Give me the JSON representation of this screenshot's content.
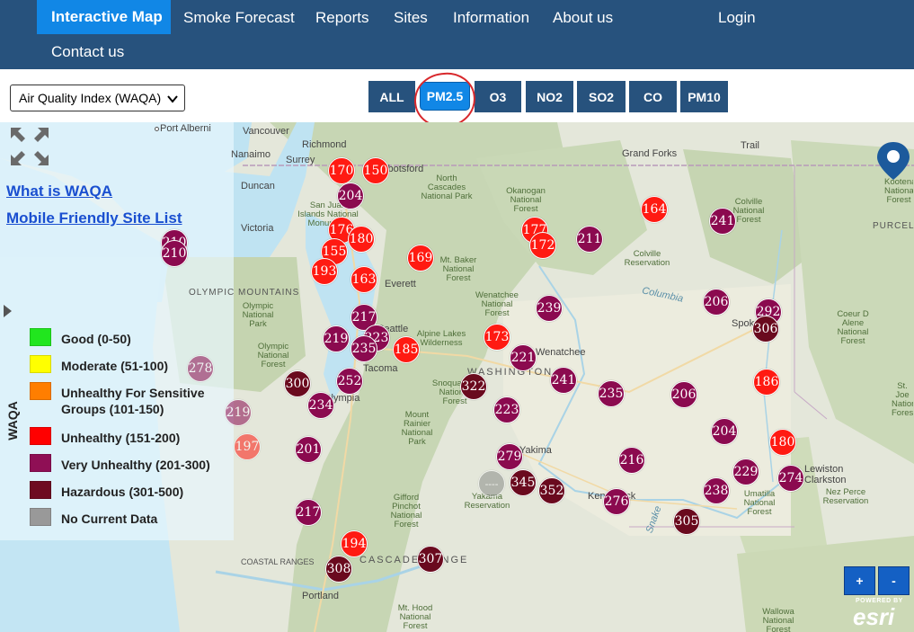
{
  "nav": {
    "items": [
      "Interactive Map",
      "Smoke Forecast",
      "Reports",
      "Sites",
      "Information",
      "About us",
      "Login",
      "Contact us"
    ]
  },
  "toolbar": {
    "select_value": "Air Quality Index (WAQA)",
    "pollutants": [
      "ALL",
      "PM2.5",
      "O3",
      "NO2",
      "SO2",
      "CO",
      "PM10"
    ],
    "active_pollutant": "PM2.5"
  },
  "links": {
    "what_is": "What is WAQA",
    "mobile_list": "Mobile Friendly Site List"
  },
  "legend": {
    "title": "WAQA",
    "items": [
      {
        "label": "Good (0-50)",
        "color": "#21e61e"
      },
      {
        "label": "Moderate (51-100)",
        "color": "#ffff00"
      },
      {
        "label": "Unhealthy For Sensitive Groups (101-150)",
        "color": "#ff7e00"
      },
      {
        "label": "Unhealthy (151-200)",
        "color": "#ff0000"
      },
      {
        "label": "Very Unhealthy (201-300)",
        "color": "#8f0f55"
      },
      {
        "label": "Hazardous (301-500)",
        "color": "#6e0b21"
      },
      {
        "label": "No Current Data",
        "color": "#999999"
      }
    ]
  },
  "map_labels": {
    "cities": [
      "Port Alberni",
      "Vancouver",
      "Richmond",
      "Surrey",
      "Abbotsford",
      "Nanaimo",
      "Duncan",
      "Victoria",
      "Grand Forks",
      "Trail",
      "Wenatchee",
      "Yakima",
      "Kennewick",
      "Lewiston",
      "Clarkston",
      "Portland",
      "Spokane",
      "Olympia",
      "Seattle",
      "Everett",
      "Tacoma"
    ],
    "regions": [
      "OLYMPIC MOUNTAINS",
      "COASTAL RANGES",
      "CASCADE RANGE",
      "WASHINGTON",
      "PURCELL"
    ],
    "parks": [
      "San Juan Islands National Monument",
      "North Cascades National Park",
      "Okanogan National Forest",
      "Colville National Forest",
      "Colville Reservation",
      "Mt. Baker National Forest",
      "Wenatchee National Forest",
      "Alpine Lakes Wilderness",
      "Olympic National Park",
      "Olympic National Forest",
      "Mount Rainier National Park",
      "Snoqualmie National Forest",
      "Gifford Pinchot National Forest",
      "Yakama Reservation",
      "Umatilla National Forest",
      "Nez Perce Reservation",
      "Coeur D Alene National Forest",
      "St. Joe National Forest",
      "Kootenai National Forest",
      "Wallowa National Forest",
      "Mt. Hood National Forest",
      "Columbia",
      "Snake"
    ]
  },
  "monitors": [
    {
      "value": "170",
      "level": "u"
    },
    {
      "value": "150",
      "level": "u"
    },
    {
      "value": "204",
      "level": "vu"
    },
    {
      "value": "176",
      "level": "u"
    },
    {
      "value": "180",
      "level": "u"
    },
    {
      "value": "155",
      "level": "u"
    },
    {
      "value": "193",
      "level": "u"
    },
    {
      "value": "163",
      "level": "u"
    },
    {
      "value": "169",
      "level": "u"
    },
    {
      "value": "210",
      "level": "vu"
    },
    {
      "value": "210",
      "level": "vu"
    },
    {
      "value": "217",
      "level": "vu"
    },
    {
      "value": "219",
      "level": "vu"
    },
    {
      "value": "223",
      "level": "vu"
    },
    {
      "value": "235",
      "level": "vu"
    },
    {
      "value": "185",
      "level": "u"
    },
    {
      "value": "173",
      "level": "u"
    },
    {
      "value": "177",
      "level": "u"
    },
    {
      "value": "172",
      "level": "u"
    },
    {
      "value": "211",
      "level": "vu"
    },
    {
      "value": "164",
      "level": "u"
    },
    {
      "value": "241",
      "level": "vu"
    },
    {
      "value": "239",
      "level": "vu"
    },
    {
      "value": "221",
      "level": "vu"
    },
    {
      "value": "241",
      "level": "vu"
    },
    {
      "value": "206",
      "level": "vu"
    },
    {
      "value": "292",
      "level": "vu"
    },
    {
      "value": "306",
      "level": "hz"
    },
    {
      "value": "278",
      "level": "vu"
    },
    {
      "value": "300",
      "level": "hz"
    },
    {
      "value": "252",
      "level": "vu"
    },
    {
      "value": "234",
      "level": "vu"
    },
    {
      "value": "322",
      "level": "hz"
    },
    {
      "value": "223",
      "level": "vu"
    },
    {
      "value": "235",
      "level": "vu"
    },
    {
      "value": "206",
      "level": "vu"
    },
    {
      "value": "186",
      "level": "u"
    },
    {
      "value": "219",
      "level": "vu"
    },
    {
      "value": "197",
      "level": "u"
    },
    {
      "value": "201",
      "level": "vu"
    },
    {
      "value": "279",
      "level": "vu"
    },
    {
      "value": "216",
      "level": "vu"
    },
    {
      "value": "204",
      "level": "vu"
    },
    {
      "value": "180",
      "level": "u"
    },
    {
      "value": "229",
      "level": "vu"
    },
    {
      "value": "274",
      "level": "vu"
    },
    {
      "value": "----",
      "level": "nd"
    },
    {
      "value": "345",
      "level": "hz"
    },
    {
      "value": "352",
      "level": "hz"
    },
    {
      "value": "276",
      "level": "vu"
    },
    {
      "value": "238",
      "level": "vu"
    },
    {
      "value": "305",
      "level": "hz"
    },
    {
      "value": "217",
      "level": "vu"
    },
    {
      "value": "194",
      "level": "u"
    },
    {
      "value": "308",
      "level": "hz"
    },
    {
      "value": "307",
      "level": "hz"
    }
  ],
  "zoom": {
    "in": "+",
    "out": "-"
  },
  "attribution": {
    "powered": "POWERED BY",
    "brand": "esri"
  }
}
